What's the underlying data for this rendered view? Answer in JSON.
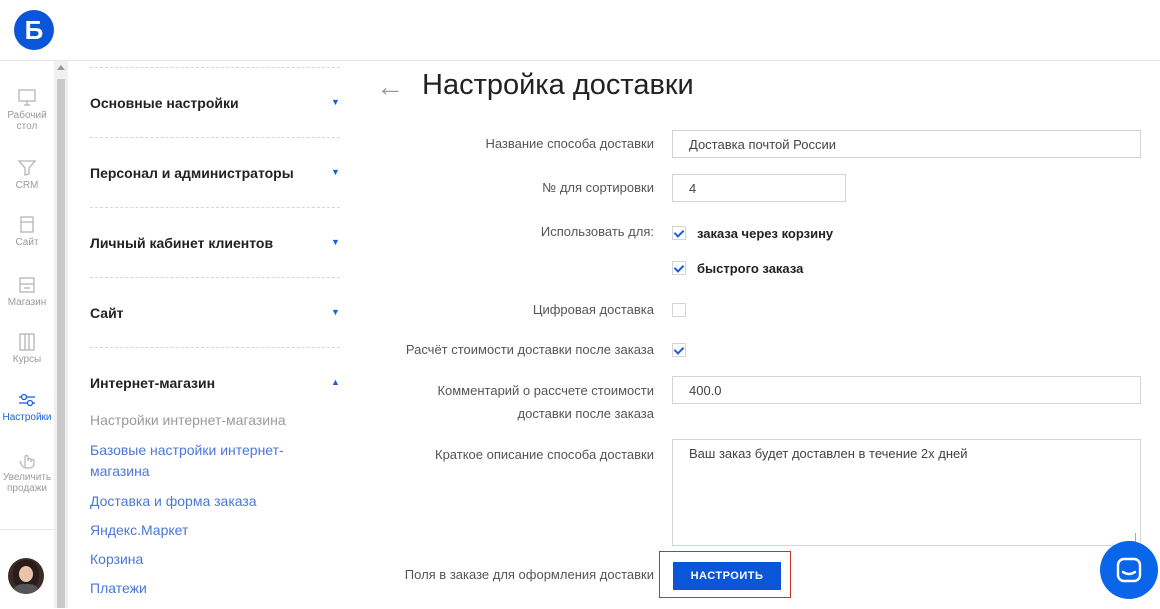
{
  "logo": {
    "letter": "Б"
  },
  "rail": {
    "items": [
      {
        "label1": "Рабочий",
        "label2": "стол",
        "icon": "monitor-icon"
      },
      {
        "label1": "CRM",
        "label2": "",
        "icon": "funnel-icon"
      },
      {
        "label1": "Сайт",
        "label2": "",
        "icon": "pages-icon"
      },
      {
        "label1": "Магазин",
        "label2": "",
        "icon": "store-icon"
      },
      {
        "label1": "Курсы",
        "label2": "",
        "icon": "columns-icon"
      },
      {
        "label1": "Настройки",
        "label2": "",
        "icon": "sliders-icon",
        "active": true
      },
      {
        "label1": "Увеличить",
        "label2": "продажи",
        "icon": "hand-icon"
      }
    ]
  },
  "menu": {
    "sections": [
      {
        "title": "Основные настройки",
        "arrow": "▼"
      },
      {
        "title": "Персонал и администраторы",
        "arrow": "▼"
      },
      {
        "title": "Личный кабинет клиентов",
        "arrow": "▼"
      },
      {
        "title": "Сайт",
        "arrow": "▼"
      },
      {
        "title": "Интернет-магазин",
        "arrow": "▲"
      }
    ],
    "shop_links": [
      "Настройки интернет-магазина",
      "Базовые настройки интернет-магазина",
      "Доставка и форма заказа",
      "Яндекс.Маркет",
      "Корзина",
      "Платежи"
    ]
  },
  "page": {
    "back": "←",
    "title": "Настройка доставки"
  },
  "form": {
    "name_label": "Название способа доставки",
    "name_value": "Доставка почтой России",
    "sort_label": "№ для сортировки",
    "sort_value": "4",
    "use_for_label": "Использовать для:",
    "use_cart_label": "заказа через корзину",
    "use_quick_label": "быстрого заказа",
    "digital_label": "Цифровая доставка",
    "calc_after_label": "Расчёт стоимости доставки после заказа",
    "comment_label_1": "Комментарий о рассчете стоимости",
    "comment_label_2": "доставки после заказа",
    "comment_value": "400.0",
    "desc_label": "Краткое описание способа доставки",
    "desc_value": "Ваш заказ будет доставлен в течение 2х дней",
    "order_fields_label": "Поля в заказе для оформления доставки",
    "configure_button": "НАСТРОИТЬ"
  },
  "colors": {
    "accent": "#0a55d8",
    "highlight": "#d0302a"
  }
}
